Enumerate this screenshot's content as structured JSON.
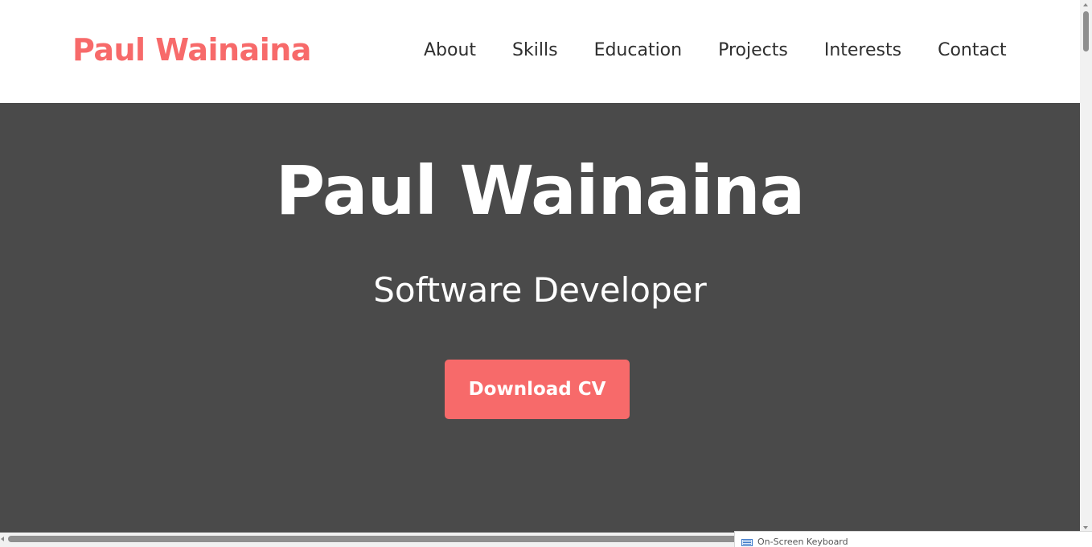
{
  "header": {
    "brand": "Paul Wainaina",
    "nav": [
      {
        "label": "About"
      },
      {
        "label": "Skills"
      },
      {
        "label": "Education"
      },
      {
        "label": "Projects"
      },
      {
        "label": "Interests"
      },
      {
        "label": "Contact"
      }
    ]
  },
  "hero": {
    "title": "Paul Wainaina",
    "subtitle": "Software Developer",
    "cta_label": "Download CV"
  },
  "taskbar": {
    "osk_label": "On-Screen Keyboard",
    "osk_icon": "keyboard-icon"
  },
  "colors": {
    "accent": "#f76a6a",
    "hero_background": "#4a4a4a",
    "nav_text": "#2f2f2f",
    "page_background": "#ffffff"
  }
}
